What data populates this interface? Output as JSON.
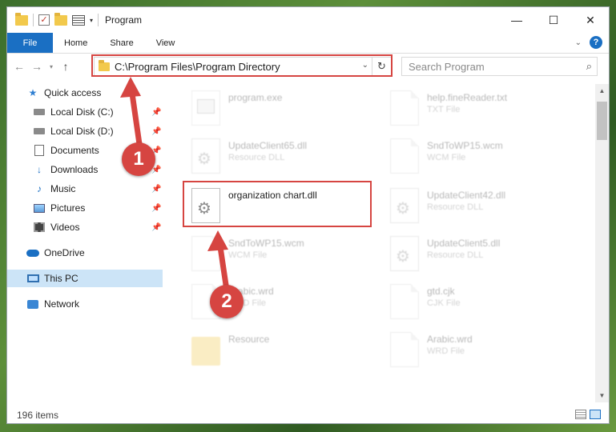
{
  "window": {
    "title": "Program",
    "controls": {
      "minimize": "—",
      "maximize": "☐",
      "close": "✕"
    }
  },
  "ribbon": {
    "tabs": [
      {
        "label": "File"
      },
      {
        "label": "Home"
      },
      {
        "label": "Share"
      },
      {
        "label": "View"
      }
    ],
    "help": "?"
  },
  "address": {
    "path": "C:\\Program Files\\Program Directory"
  },
  "search": {
    "placeholder": "Search Program"
  },
  "sidebar": {
    "items": [
      {
        "label": "Quick access",
        "pinned": false
      },
      {
        "label": "Local Disk (C:)",
        "pinned": true
      },
      {
        "label": "Local Disk (D:)",
        "pinned": true
      },
      {
        "label": "Documents",
        "pinned": true
      },
      {
        "label": "Downloads",
        "pinned": true
      },
      {
        "label": "Music",
        "pinned": true
      },
      {
        "label": "Pictures",
        "pinned": true
      },
      {
        "label": "Videos",
        "pinned": true
      },
      {
        "label": "OneDrive",
        "pinned": false
      },
      {
        "label": "This PC",
        "pinned": false,
        "selected": true
      },
      {
        "label": "Network",
        "pinned": false
      }
    ]
  },
  "files": [
    {
      "name": "program.exe",
      "type": ""
    },
    {
      "name": "help.fineReader.txt",
      "type": "TXT File"
    },
    {
      "name": "UpdateClient65.dll",
      "type": "Resource DLL"
    },
    {
      "name": "SndToWP15.wcm",
      "type": "WCM File"
    },
    {
      "name": "organization chart.dll",
      "type": ""
    },
    {
      "name": "UpdateClient42.dll",
      "type": "Resource DLL"
    },
    {
      "name": "SndToWP15.wcm",
      "type": "WCM File"
    },
    {
      "name": "UpdateClient5.dll",
      "type": "Resource DLL"
    },
    {
      "name": "Arabic.wrd",
      "type": "WRD File"
    },
    {
      "name": "gtd.cjk",
      "type": "CJK File"
    },
    {
      "name": "Resource",
      "type": ""
    },
    {
      "name": "Arabic.wrd",
      "type": "WRD File"
    }
  ],
  "status": {
    "item_count": "196 items"
  },
  "annotations": {
    "step1": "1",
    "step2": "2",
    "color": "#d64541"
  }
}
